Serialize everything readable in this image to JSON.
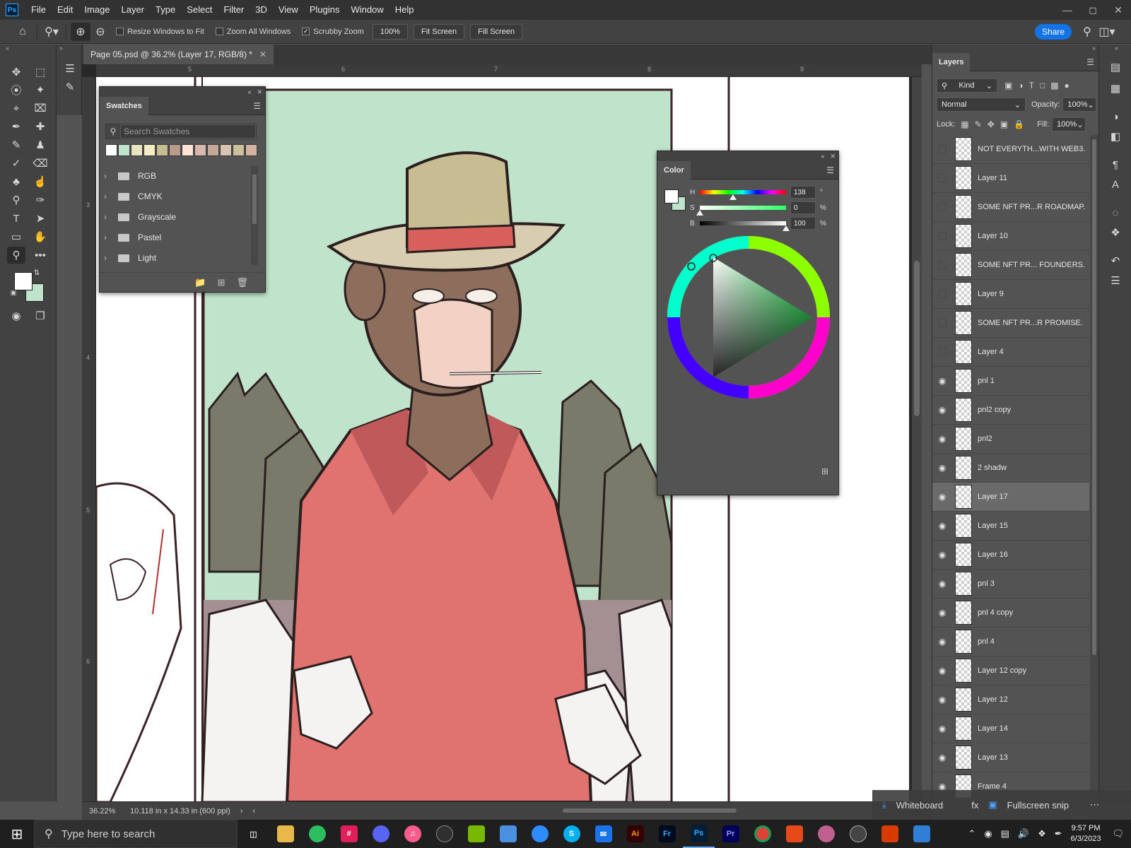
{
  "menubar": {
    "items": [
      "File",
      "Edit",
      "Image",
      "Layer",
      "Type",
      "Select",
      "Filter",
      "3D",
      "View",
      "Plugins",
      "Window",
      "Help"
    ]
  },
  "options": {
    "resize_windows": "Resize Windows to Fit",
    "zoom_all": "Zoom All Windows",
    "scrubby": "Scrubby Zoom",
    "zoom_value": "100%",
    "fit_screen": "Fit Screen",
    "fill_screen": "Fill Screen",
    "share": "Share"
  },
  "document": {
    "tab_title": "Page 05.psd @ 36.2% (Layer 17, RGB/8) *",
    "ruler_top": [
      "5",
      "6",
      "7",
      "8",
      "9"
    ],
    "ruler_left": [
      "3",
      "4",
      "5",
      "6"
    ]
  },
  "status": {
    "zoom": "36.22%",
    "doc_info": "10.118 in x 14.33 in (600 ppi)"
  },
  "colors": {
    "foreground": "#ffffff",
    "background": "#c0e4cb",
    "panel_bg": "#535353",
    "accent": "#1473e6"
  },
  "swatches": {
    "title": "Swatches",
    "search_placeholder": "Search Swatches",
    "recent": [
      "#ffffff",
      "#c0e4cb",
      "#e8e4c0",
      "#f4eec8",
      "#c8bd92",
      "#b89b8a",
      "#fde4d6",
      "#d8b8aa",
      "#c4a898",
      "#d6c4b0",
      "#cbbf9e",
      "#d4b4a0"
    ],
    "groups": [
      "RGB",
      "CMYK",
      "Grayscale",
      "Pastel",
      "Light"
    ]
  },
  "color_panel": {
    "title": "Color",
    "h_label": "H",
    "h_value": "138",
    "h_unit": "°",
    "s_label": "S",
    "s_value": "0",
    "s_unit": "%",
    "b_label": "B",
    "b_value": "100",
    "b_unit": "%"
  },
  "layers": {
    "title": "Layers",
    "kind": "Kind",
    "blend": "Normal",
    "opacity_label": "Opacity:",
    "opacity": "100%",
    "lock_label": "Lock:",
    "fill_label": "Fill:",
    "fill": "100%",
    "rows": [
      {
        "name": "NOT EVERYTH...WITH WEB3.",
        "visible": false
      },
      {
        "name": "Layer 11",
        "visible": false
      },
      {
        "name": "SOME NFT PR...R ROADMAP.",
        "visible": false
      },
      {
        "name": "Layer 10",
        "visible": false
      },
      {
        "name": "SOME NFT PR... FOUNDERS.",
        "visible": false
      },
      {
        "name": "Layer 9",
        "visible": false
      },
      {
        "name": "SOME NFT PR...R PROMISE.",
        "visible": false
      },
      {
        "name": "Layer 4",
        "visible": false
      },
      {
        "name": "pnl 1",
        "visible": true
      },
      {
        "name": "pnl2 copy",
        "visible": true
      },
      {
        "name": "pnl2",
        "visible": true
      },
      {
        "name": "2 shadw",
        "visible": true
      },
      {
        "name": "Layer 17",
        "visible": true,
        "selected": true
      },
      {
        "name": "Layer 15",
        "visible": true
      },
      {
        "name": "Layer 16",
        "visible": true
      },
      {
        "name": "pnl 3",
        "visible": true
      },
      {
        "name": "pnl 4 copy",
        "visible": true
      },
      {
        "name": "pnl 4",
        "visible": true
      },
      {
        "name": "Layer 12 copy",
        "visible": true
      },
      {
        "name": "Layer 12",
        "visible": true
      },
      {
        "name": "Layer 14",
        "visible": true
      },
      {
        "name": "Layer 13",
        "visible": true
      },
      {
        "name": "Frame 4",
        "visible": true
      }
    ]
  },
  "snip": {
    "whiteboard": "Whiteboard",
    "fullscreen": "Fullscreen snip"
  },
  "taskbar": {
    "search_placeholder": "Type here to search",
    "time": "9:57 PM",
    "date": "6/3/2023"
  }
}
